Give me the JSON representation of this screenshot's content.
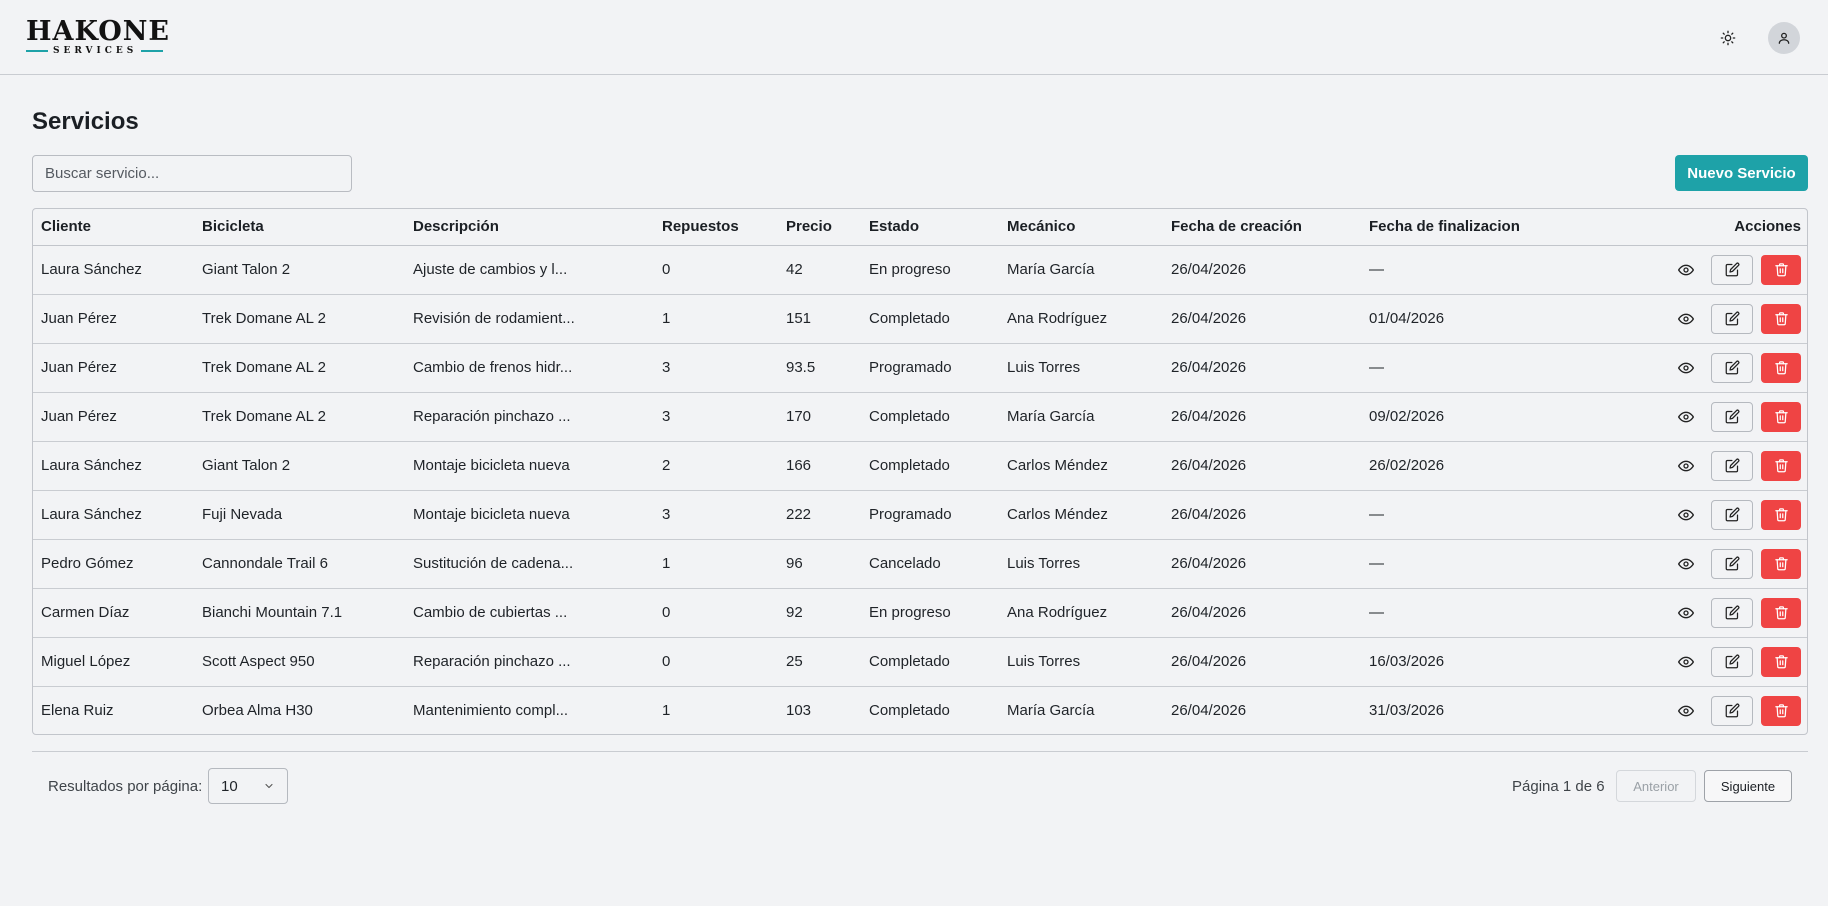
{
  "header": {
    "logo_text": "HAKONE",
    "logo_subtext": "SERVICES"
  },
  "page": {
    "title": "Servicios",
    "search_placeholder": "Buscar servicio...",
    "new_button": "Nuevo Servicio"
  },
  "table": {
    "headers": [
      "Cliente",
      "Bicicleta",
      "Descripción",
      "Repuestos",
      "Precio",
      "Estado",
      "Mecánico",
      "Fecha de creación",
      "Fecha de finalizacion",
      "Acciones"
    ],
    "rows": [
      [
        "Laura Sánchez",
        "Giant Talon 2",
        "Ajuste de cambios y l...",
        "0",
        "42",
        "En progreso",
        "María García",
        "26/04/2026",
        "—"
      ],
      [
        "Juan Pérez",
        "Trek Domane AL 2",
        "Revisión de rodamient...",
        "1",
        "151",
        "Completado",
        "Ana Rodríguez",
        "26/04/2026",
        "01/04/2026"
      ],
      [
        "Juan Pérez",
        "Trek Domane AL 2",
        "Cambio de frenos hidr...",
        "3",
        "93.5",
        "Programado",
        "Luis Torres",
        "26/04/2026",
        "—"
      ],
      [
        "Juan Pérez",
        "Trek Domane AL 2",
        "Reparación pinchazo ...",
        "3",
        "170",
        "Completado",
        "María García",
        "26/04/2026",
        "09/02/2026"
      ],
      [
        "Laura Sánchez",
        "Giant Talon 2",
        "Montaje bicicleta nueva",
        "2",
        "166",
        "Completado",
        "Carlos Méndez",
        "26/04/2026",
        "26/02/2026"
      ],
      [
        "Laura Sánchez",
        "Fuji Nevada",
        "Montaje bicicleta nueva",
        "3",
        "222",
        "Programado",
        "Carlos Méndez",
        "26/04/2026",
        "—"
      ],
      [
        "Pedro Gómez",
        "Cannondale Trail 6",
        "Sustitución de cadena...",
        "1",
        "96",
        "Cancelado",
        "Luis Torres",
        "26/04/2026",
        "—"
      ],
      [
        "Carmen Díaz",
        "Bianchi Mountain 7.1",
        "Cambio de cubiertas ...",
        "0",
        "92",
        "En progreso",
        "Ana Rodríguez",
        "26/04/2026",
        "—"
      ],
      [
        "Miguel López",
        "Scott Aspect 950",
        "Reparación pinchazo ...",
        "0",
        "25",
        "Completado",
        "Luis Torres",
        "26/04/2026",
        "16/03/2026"
      ],
      [
        "Elena Ruiz",
        "Orbea Alma H30",
        "Mantenimiento compl...",
        "1",
        "103",
        "Completado",
        "María García",
        "26/04/2026",
        "31/03/2026"
      ]
    ]
  },
  "pagination": {
    "rpp_label": "Resultados por página:",
    "rpp_value": "10",
    "page_info": "Página 1 de 6",
    "prev": "Anterior",
    "next": "Siguiente"
  },
  "icons": {
    "theme": "sun-icon",
    "user": "user-icon",
    "view": "eye-icon",
    "edit": "edit-icon",
    "delete": "trash-icon",
    "select": "chevron-down-icon"
  },
  "colors": {
    "accent": "#1ea2a8",
    "danger": "#ef4444",
    "background": "#f2f3f5"
  }
}
